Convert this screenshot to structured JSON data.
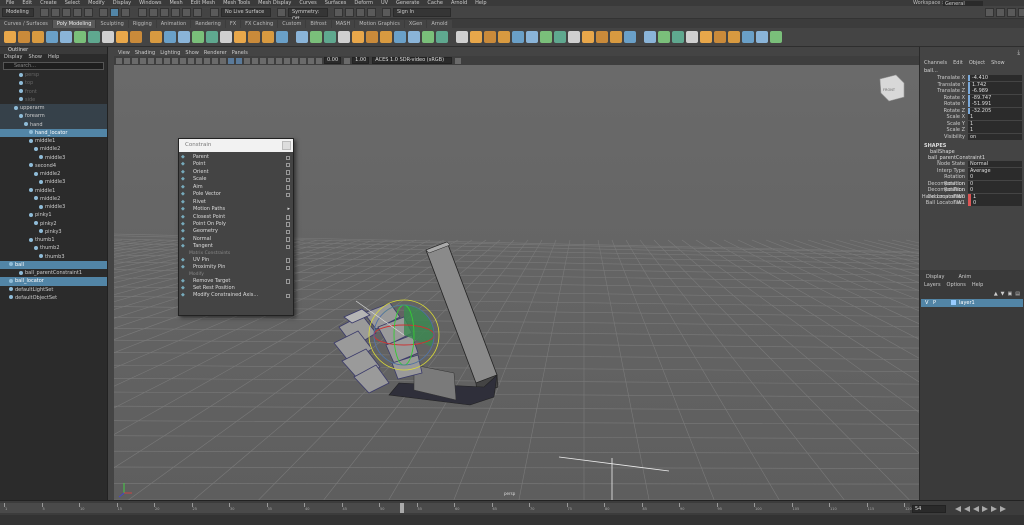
{
  "menubar": {
    "items": [
      "File",
      "Edit",
      "Create",
      "Select",
      "Modify",
      "Display",
      "Windows",
      "Mesh",
      "Edit Mesh",
      "Mesh Tools",
      "Mesh Display",
      "Curves",
      "Surfaces",
      "Deform",
      "UV",
      "Generate",
      "Cache",
      "Arnold",
      "Help"
    ],
    "workspace_label": "Workspace :",
    "workspace_value": "General"
  },
  "statusline": {
    "mode": "Modeling",
    "live_surface": "No Live Surface",
    "symmetry": "Symmetry: Off",
    "sign_in": "Sign In"
  },
  "shelf_tabs": [
    {
      "label": "Curves / Surfaces",
      "active": false
    },
    {
      "label": "Poly Modeling",
      "active": true
    },
    {
      "label": "Sculpting",
      "active": false
    },
    {
      "label": "Rigging",
      "active": false
    },
    {
      "label": "Animation",
      "active": false
    },
    {
      "label": "Rendering",
      "active": false
    },
    {
      "label": "FX",
      "active": false
    },
    {
      "label": "FX Caching",
      "active": false
    },
    {
      "label": "Custom",
      "active": false
    },
    {
      "label": "Bifrost",
      "active": false
    },
    {
      "label": "MASH",
      "active": false
    },
    {
      "label": "Motion Graphics",
      "active": false
    },
    {
      "label": "XGen",
      "active": false
    },
    {
      "label": "Arnold",
      "active": false
    }
  ],
  "outliner": {
    "title": "Outliner",
    "menu": [
      "Display",
      "Show",
      "Help"
    ],
    "search_placeholder": "Search...",
    "items": [
      {
        "label": "persp",
        "indent": 3,
        "state": "dim"
      },
      {
        "label": "top",
        "indent": 3,
        "state": "dim"
      },
      {
        "label": "front",
        "indent": 3,
        "state": "dim"
      },
      {
        "label": "side",
        "indent": 3,
        "state": "dim"
      },
      {
        "label": "upperarm",
        "indent": 2,
        "state": "hl"
      },
      {
        "label": "forearm",
        "indent": 3,
        "state": "hl"
      },
      {
        "label": "hand",
        "indent": 4,
        "state": "hl"
      },
      {
        "label": "hand_locator",
        "indent": 5,
        "state": "sel"
      },
      {
        "label": "middle1",
        "indent": 5,
        "state": ""
      },
      {
        "label": "middle2",
        "indent": 6,
        "state": ""
      },
      {
        "label": "middle3",
        "indent": 7,
        "state": ""
      },
      {
        "label": "second4",
        "indent": 5,
        "state": ""
      },
      {
        "label": "middle2",
        "indent": 6,
        "state": ""
      },
      {
        "label": "middle3",
        "indent": 7,
        "state": ""
      },
      {
        "label": "middle1",
        "indent": 5,
        "state": ""
      },
      {
        "label": "middle2",
        "indent": 6,
        "state": ""
      },
      {
        "label": "middle3",
        "indent": 7,
        "state": ""
      },
      {
        "label": "pinky1",
        "indent": 5,
        "state": ""
      },
      {
        "label": "pinky2",
        "indent": 6,
        "state": ""
      },
      {
        "label": "pinky3",
        "indent": 7,
        "state": ""
      },
      {
        "label": "thumb1",
        "indent": 5,
        "state": ""
      },
      {
        "label": "thumb2",
        "indent": 6,
        "state": ""
      },
      {
        "label": "thumb3",
        "indent": 7,
        "state": ""
      },
      {
        "label": "ball",
        "indent": 1,
        "state": "sel"
      },
      {
        "label": "ball_parentConstraint1",
        "indent": 3,
        "state": ""
      },
      {
        "label": "ball_locator",
        "indent": 1,
        "state": "sel"
      },
      {
        "label": "defaultLightSet",
        "indent": 1,
        "state": ""
      },
      {
        "label": "defaultObjectSet",
        "indent": 1,
        "state": ""
      }
    ]
  },
  "viewport": {
    "menu": [
      "View",
      "Shading",
      "Lighting",
      "Show",
      "Renderer",
      "Panels"
    ],
    "field_a": "0.00",
    "field_b": "1.00",
    "colorspace": "ACES 1.0 SDR-video (sRGB)",
    "camera_label": "persp",
    "view_cube_label": "FRONT"
  },
  "constrain_menu": {
    "title": "Constrain",
    "items": [
      {
        "label": "Parent",
        "kind": "opt"
      },
      {
        "label": "Point",
        "kind": "opt"
      },
      {
        "label": "Orient",
        "kind": "opt"
      },
      {
        "label": "Scale",
        "kind": "opt"
      },
      {
        "label": "Aim",
        "kind": "opt"
      },
      {
        "label": "Pole Vector",
        "kind": "opt"
      },
      {
        "label": "Rivet",
        "kind": "plain"
      },
      {
        "label": "Motion Paths",
        "kind": "sub"
      },
      {
        "label": "Closest Point",
        "kind": "opt"
      },
      {
        "label": "Point On Poly",
        "kind": "opt"
      },
      {
        "label": "Geometry",
        "kind": "opt"
      },
      {
        "label": "Normal",
        "kind": "opt"
      },
      {
        "label": "Tangent",
        "kind": "opt"
      },
      {
        "label": "Matrix Constraints",
        "kind": "section"
      },
      {
        "label": "UV Pin",
        "kind": "opt"
      },
      {
        "label": "Proximity Pin",
        "kind": "opt"
      },
      {
        "label": "Modify",
        "kind": "section"
      },
      {
        "label": "Remove Target",
        "kind": "opt"
      },
      {
        "label": "Set Rest Position",
        "kind": "plain"
      },
      {
        "label": "Modify Constrained Axis...",
        "kind": "opt"
      }
    ]
  },
  "channel_box": {
    "menu": [
      "Channels",
      "Edit",
      "Object",
      "Show"
    ],
    "object_name": "ball...",
    "attributes": [
      {
        "label": "Translate X",
        "value": "-4.410",
        "accent": "blue"
      },
      {
        "label": "Translate Y",
        "value": "1.742",
        "accent": "blue"
      },
      {
        "label": "Translate Z",
        "value": "-6.989",
        "accent": "blue"
      },
      {
        "label": "Rotate X",
        "value": "-89.747",
        "accent": "blue"
      },
      {
        "label": "Rotate Y",
        "value": "-51.991",
        "accent": "blue"
      },
      {
        "label": "Rotate Z",
        "value": "-32.205",
        "accent": "blue"
      },
      {
        "label": "Scale X",
        "value": "1",
        "accent": ""
      },
      {
        "label": "Scale Y",
        "value": "1",
        "accent": ""
      },
      {
        "label": "Scale Z",
        "value": "1",
        "accent": ""
      },
      {
        "label": "Visibility",
        "value": "on",
        "accent": ""
      }
    ],
    "shapes_header": "SHAPES",
    "shape_name": "ballShape",
    "inputs_name": "ball_parentConstraint1",
    "inputs": [
      {
        "label": "Node State",
        "value": "Normal",
        "accent": ""
      },
      {
        "label": "Interp Type",
        "value": "Average",
        "accent": ""
      },
      {
        "label": "Rotation Decomposition Tar...",
        "value": "0",
        "accent": ""
      },
      {
        "label": "Rotation Decomposition Tar...",
        "value": "0",
        "accent": ""
      },
      {
        "label": "Rotation Decomposition Tar...",
        "value": "0",
        "accent": ""
      },
      {
        "label": "Hand Locator W0",
        "value": "1",
        "accent": "red"
      },
      {
        "label": "Ball Locator W1",
        "value": "0",
        "accent": "red"
      }
    ]
  },
  "layers": {
    "tabs": [
      "Display",
      "Anim"
    ],
    "menu": [
      "Layers",
      "Options",
      "Help"
    ],
    "layer_flag_v": "V",
    "layer_flag_p": "P",
    "layer_name": "layer1"
  },
  "timeline": {
    "ticks": [
      "1",
      "5",
      "10",
      "15",
      "20",
      "25",
      "30",
      "35",
      "40",
      "45",
      "50",
      "55",
      "60",
      "65",
      "70",
      "75",
      "80",
      "85",
      "90",
      "95",
      "100",
      "105",
      "110",
      "115",
      "120"
    ],
    "current_frame": "54",
    "current_frame_fraction": 0.44
  },
  "colors": {
    "selection": "#5285a6",
    "viewport_bg": "#6a6a6a",
    "panel_bg": "#444444"
  }
}
